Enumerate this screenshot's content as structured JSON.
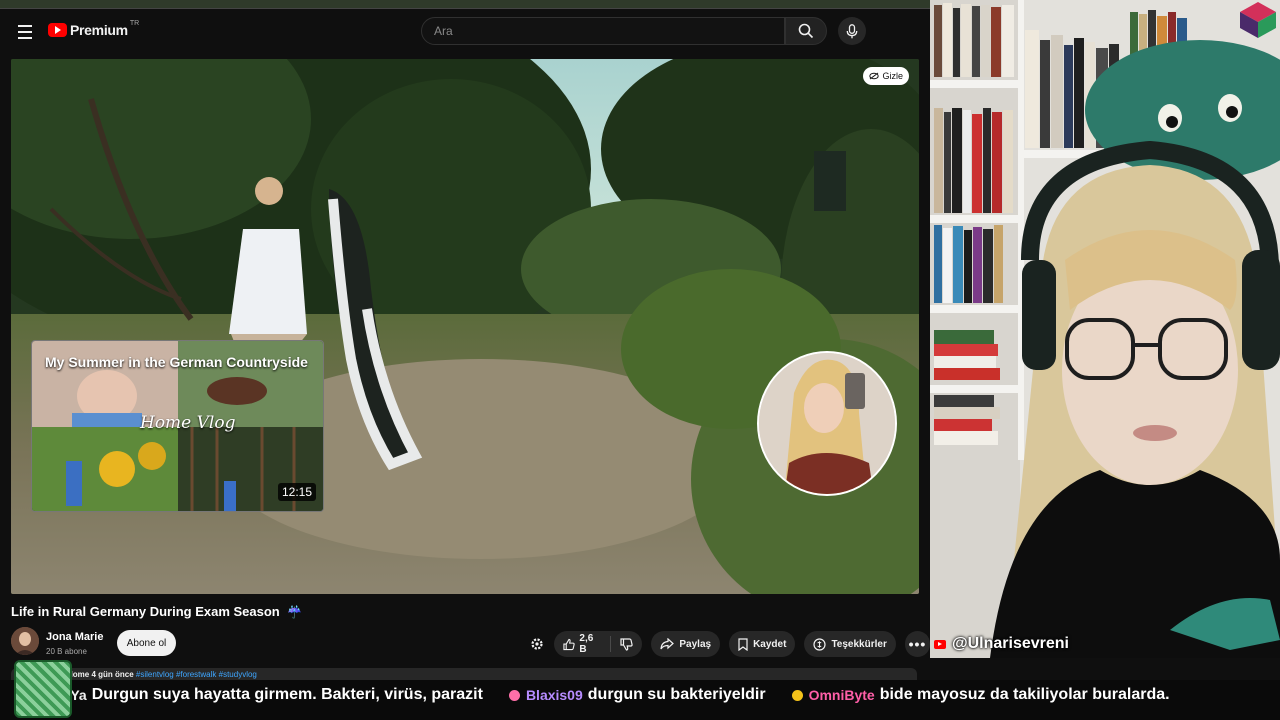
{
  "header": {
    "logo_text": "Premium",
    "logo_region": "TR",
    "search_placeholder": "Ara"
  },
  "player": {
    "hide_label": "Gizle",
    "endcard": {
      "title": "My Summer in the German Countryside",
      "script_text": "Home Vlog",
      "duration": "12:15"
    }
  },
  "video": {
    "title": "Life in Rural Germany During Exam Season",
    "channel_name": "Jona Marie",
    "subscribers": "20 B abone",
    "subscribe_label": "Abone ol",
    "likes": "2,6 B",
    "share_label": "Paylaş",
    "save_label": "Kaydet",
    "thanks_label": "Teşekkürler",
    "description_meta": "Home 4 gün önce",
    "description_tags": "#silentvlog #forestwalk #studyvlog"
  },
  "stream": {
    "handle": "@Ulnarisevreni"
  },
  "chat": [
    {
      "user": "GormYa",
      "text": "Durgun suya hayatta girmem. Bakteri, virüs, parazit",
      "user_color": "#f1f1f1",
      "badge_color": "#f4c21a"
    },
    {
      "user": "Blaxis09",
      "text": "durgun su bakteriyeldir",
      "user_color": "#b68cff",
      "badge_color": "#ff6fa8"
    },
    {
      "user": "OmniByte",
      "text": "bide mayosuz da takiliyolar buralarda.",
      "user_color": "#ff5fa8",
      "badge_color": "#f4c21a"
    }
  ],
  "colors": {
    "background": "#0f0f0f",
    "brand_red": "#ff0000",
    "pill_bg": "#272727"
  }
}
